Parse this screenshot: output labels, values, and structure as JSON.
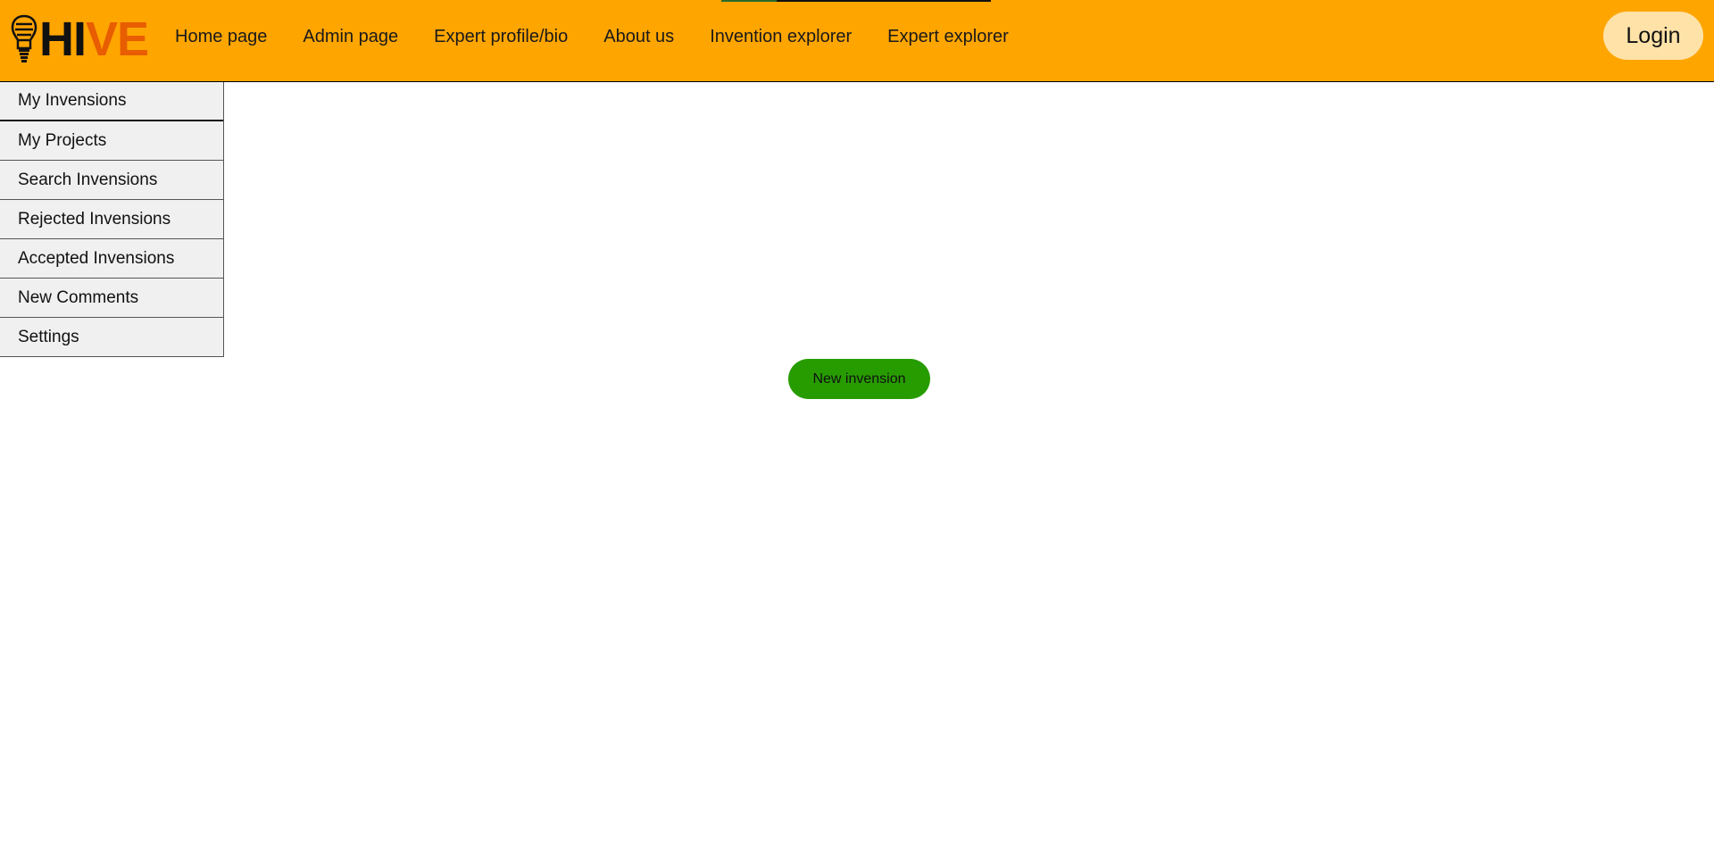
{
  "logo": {
    "text_part1": "HI",
    "text_part2": "VE",
    "icon": "lightbulb-icon",
    "color_part1": "#111111",
    "color_part2": "#e85d00"
  },
  "header": {
    "background": "#ffa500",
    "nav": [
      {
        "label": "Home page"
      },
      {
        "label": "Admin page"
      },
      {
        "label": "Expert profile/bio"
      },
      {
        "label": "About us"
      },
      {
        "label": "Invention explorer"
      },
      {
        "label": "Expert explorer"
      }
    ],
    "login_label": "Login"
  },
  "sidebar": {
    "items": [
      {
        "label": "My Invensions",
        "active": true
      },
      {
        "label": "My Projects"
      },
      {
        "label": "Search Invensions"
      },
      {
        "label": "Rejected Invensions"
      },
      {
        "label": "Accepted Invensions"
      },
      {
        "label": "New Comments"
      },
      {
        "label": "Settings"
      }
    ]
  },
  "main": {
    "new_button_label": "New invension",
    "new_button_color": "#279c00"
  }
}
